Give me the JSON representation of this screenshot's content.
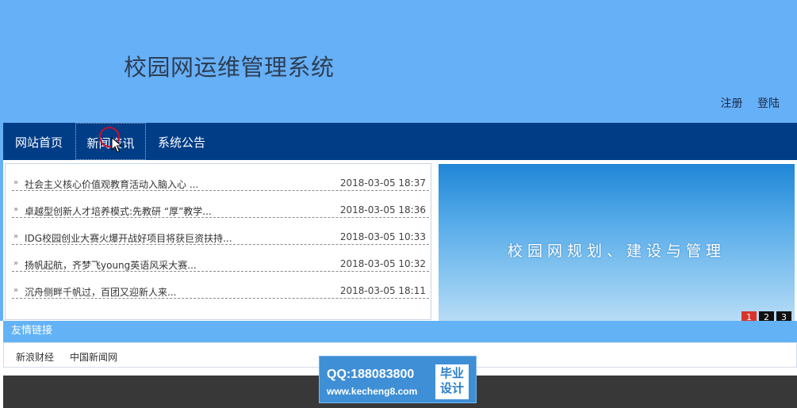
{
  "header": {
    "site_title": "校园网运维管理系统",
    "register_label": "注册",
    "login_label": "登陆"
  },
  "nav": {
    "items": [
      {
        "label": "网站首页"
      },
      {
        "label": "新闻资讯"
      },
      {
        "label": "系统公告"
      }
    ],
    "active_index": 1
  },
  "news": {
    "bullet_glyph": "»",
    "items": [
      {
        "title": "社会主义核心价值观教育活动入脑入心 ...",
        "date": "2018-03-05 18:37"
      },
      {
        "title": "卓越型创新人才培养模式:先教研 “厚”教学...",
        "date": "2018-03-05 18:36"
      },
      {
        "title": "IDG校园创业大赛火爆开战好项目将获巨资扶持...",
        "date": "2018-03-05 10:33"
      },
      {
        "title": "扬帆起航，齐梦飞young英语风采大赛...",
        "date": "2018-03-05 10:32"
      },
      {
        "title": "沉舟侧畔千帆过，百团又迎新人来...",
        "date": "2018-03-05 18:11"
      }
    ]
  },
  "banner": {
    "text": "校园网规划、建设与管理",
    "pages": [
      "1",
      "2",
      "3"
    ],
    "active_page": 1
  },
  "links": {
    "heading": "友情链接",
    "items": [
      {
        "label": "新浪财经"
      },
      {
        "label": "中国新闻网"
      }
    ]
  },
  "watermark": {
    "qq": "QQ:188083800",
    "url": "www.kecheng8.com",
    "badge_line1": "毕业",
    "badge_line2": "设计"
  },
  "colors": {
    "header_bg": "#66b0f8",
    "nav_bg": "#003d87",
    "links_header_bg": "#63b2f6",
    "pager_active": "#d9342b",
    "footer_bg": "#383838"
  },
  "icons": {
    "cursor": "mouse-pointer-icon",
    "bullet": "double-chevron-right-icon"
  }
}
